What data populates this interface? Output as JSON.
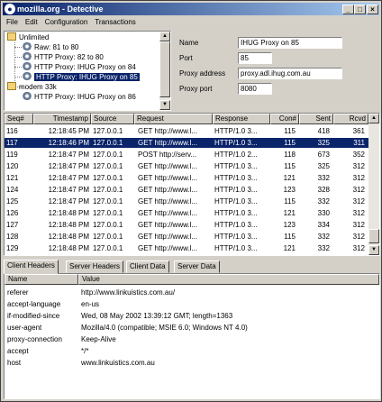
{
  "window": {
    "title": "mozilla.org - Detective",
    "app_icon": "mozilla-icon"
  },
  "menu": [
    "File",
    "Edit",
    "Configuration",
    "Transactions"
  ],
  "tree": {
    "groups": [
      {
        "label": "Unlimited",
        "children": [
          "Raw: 81 to 80",
          "HTTP Proxy: 82 to 80",
          "HTTP Proxy: IHUG Proxy on 84",
          "HTTP Proxy: IHUG Proxy on 85"
        ]
      },
      {
        "label": "modem 33k",
        "children": [
          "HTTP Proxy: IHUG Proxy on 86"
        ]
      }
    ],
    "selected": "HTTP Proxy: IHUG Proxy on 85"
  },
  "properties": {
    "name_label": "Name",
    "name_value": "IHUG Proxy on 85",
    "port_label": "Port",
    "port_value": "85",
    "proxy_address_label": "Proxy address",
    "proxy_address_value": "proxy.adl.ihug.com.au",
    "proxy_port_label": "Proxy port",
    "proxy_port_value": "8080"
  },
  "grid": {
    "columns": [
      "Seq#",
      "Timestamp",
      "Source",
      "Request",
      "Response",
      "Con#",
      "Sent",
      "Rcvd"
    ],
    "selected_index": 1,
    "rows": [
      [
        "116",
        "12:18:45 PM",
        "127.0.0.1",
        "GET http://www.l...",
        "HTTP/1.0 3...",
        "115",
        "418",
        "361"
      ],
      [
        "117",
        "12:18:46 PM",
        "127.0.0.1",
        "GET http://www.l...",
        "HTTP/1.0 3...",
        "115",
        "325",
        "311"
      ],
      [
        "119",
        "12:18:47 PM",
        "127.0.0.1",
        "POST http://serv...",
        "HTTP/1.0 2...",
        "118",
        "673",
        "352"
      ],
      [
        "120",
        "12:18:47 PM",
        "127.0.0.1",
        "GET http://www.l...",
        "HTTP/1.0 3...",
        "115",
        "325",
        "312"
      ],
      [
        "121",
        "12:18:47 PM",
        "127.0.0.1",
        "GET http://www.l...",
        "HTTP/1.0 3...",
        "121",
        "332",
        "312"
      ],
      [
        "124",
        "12:18:47 PM",
        "127.0.0.1",
        "GET http://www.l...",
        "HTTP/1.0 3...",
        "123",
        "328",
        "312"
      ],
      [
        "125",
        "12:18:47 PM",
        "127.0.0.1",
        "GET http://www.l...",
        "HTTP/1.0 3...",
        "115",
        "332",
        "312"
      ],
      [
        "126",
        "12:18:48 PM",
        "127.0.0.1",
        "GET http://www.l...",
        "HTTP/1.0 3...",
        "121",
        "330",
        "312"
      ],
      [
        "127",
        "12:18:48 PM",
        "127.0.0.1",
        "GET http://www.l...",
        "HTTP/1.0 3...",
        "123",
        "334",
        "312"
      ],
      [
        "128",
        "12:18:48 PM",
        "127.0.0.1",
        "GET http://www.l...",
        "HTTP/1.0 3...",
        "115",
        "332",
        "312"
      ],
      [
        "129",
        "12:18:48 PM",
        "127.0.0.1",
        "GET http://www.l...",
        "HTTP/1.0 3...",
        "121",
        "332",
        "312"
      ]
    ]
  },
  "tabs": [
    "Client Headers",
    "Server Headers",
    "Client Data",
    "Server Data"
  ],
  "active_tab": 0,
  "headers": {
    "columns": [
      "Name",
      "Value"
    ],
    "rows": [
      [
        "referer",
        "http://www.linkuistics.com.au/"
      ],
      [
        "accept-language",
        "en-us"
      ],
      [
        "if-modified-since",
        "Wed, 08 May 2002 13:39:12 GMT; length=1363"
      ],
      [
        "user-agent",
        "Mozilla/4.0 (compatible; MSIE 6.0; Windows NT 4.0)"
      ],
      [
        "proxy-connection",
        "Keep-Alive"
      ],
      [
        "accept",
        "*/*"
      ],
      [
        "host",
        "www.linkuistics.com.au"
      ]
    ]
  },
  "colors": {
    "selection": "#0a246a",
    "title_start": "#0a246a",
    "title_end": "#a6caf0",
    "face": "#d4d0c8"
  }
}
